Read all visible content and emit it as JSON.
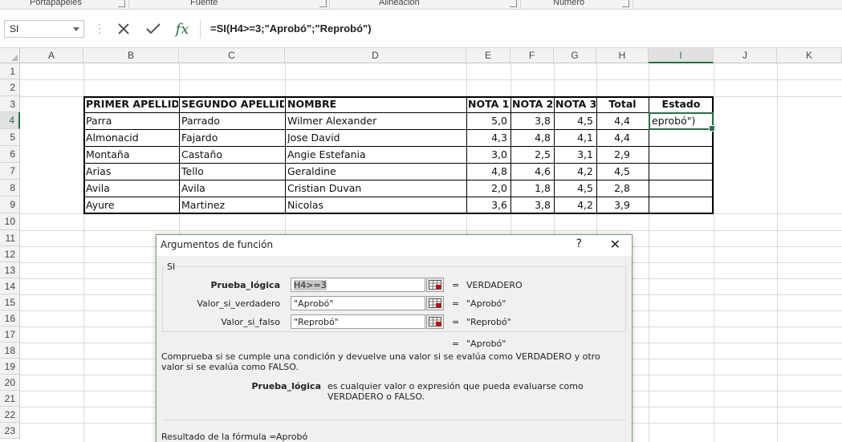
{
  "ribbon": {
    "groups": [
      {
        "label": "Portapapeles"
      },
      {
        "label": "Fuente"
      },
      {
        "label": "Alineación"
      },
      {
        "label": "Número"
      }
    ]
  },
  "formula_bar": {
    "name_box": "SI",
    "formula": "=SI(H4>=3;\"Aprobó\";\"Reprobó\")",
    "fx_label": "fx"
  },
  "columns": [
    "A",
    "B",
    "C",
    "D",
    "E",
    "F",
    "G",
    "H",
    "I",
    "J",
    "K"
  ],
  "rows": [
    "1",
    "2",
    "3",
    "4",
    "5",
    "6",
    "7",
    "8",
    "9",
    "10",
    "11",
    "12",
    "13",
    "14",
    "15",
    "16",
    "17",
    "18",
    "19",
    "20",
    "21",
    "22",
    "23"
  ],
  "table": {
    "headers": [
      "PRIMER APELLIDO",
      "SEGUNDO APELLIDO",
      "NOMBRE",
      "NOTA 1",
      "NOTA 2",
      "NOTA 3",
      "Total",
      "Estado"
    ],
    "rows": [
      [
        "Parra",
        "Parrado",
        "Wilmer Alexander",
        "5,0",
        "3,8",
        "4,5",
        "4,4",
        "eprobó\")"
      ],
      [
        "Almonacid",
        "Fajardo",
        "Jose David",
        "4,3",
        "4,8",
        "4,1",
        "4,4",
        ""
      ],
      [
        "Montaña",
        "Castaño",
        "Angie Estefania",
        "3,0",
        "2,5",
        "3,1",
        "2,9",
        ""
      ],
      [
        "Arias",
        "Tello",
        "Geraldine",
        "4,8",
        "4,6",
        "4,2",
        "4,5",
        ""
      ],
      [
        "Avila",
        "Avila",
        "Cristian Duvan",
        "2,0",
        "1,8",
        "4,5",
        "2,8",
        ""
      ],
      [
        "Ayure",
        "Martinez",
        "Nicolas",
        "3,6",
        "3,8",
        "4,2",
        "3,9",
        ""
      ]
    ]
  },
  "dialog": {
    "title": "Argumentos de función",
    "help": "?",
    "close": "✕",
    "function_name": "SI",
    "args": [
      {
        "label": "Prueba_lógica",
        "value": "H4>=3",
        "result": "VERDADERO"
      },
      {
        "label": "Valor_si_verdadero",
        "value": "\"Aprobó\"",
        "result": "\"Aprobó\""
      },
      {
        "label": "Valor_si_falso",
        "value": "\"Reprobó\"",
        "result": "\"Reprobó\""
      }
    ],
    "eq": "=",
    "overall_result": "\"Aprobó\"",
    "description": "Comprueba si se cumple una condición y devuelve una valor si se evalúa como VERDADERO y otro valor si se evalúa como FALSO.",
    "arg_help_name": "Prueba_lógica",
    "arg_help_text": "es cualquier valor o expresión que pueda evaluarse como VERDADERO o FALSO.",
    "formula_result_label": "Resultado de la fórmula =",
    "formula_result_value": "Aprobó"
  },
  "colors": {
    "accent": "#217346",
    "header_bg": "#f2f2f2"
  }
}
